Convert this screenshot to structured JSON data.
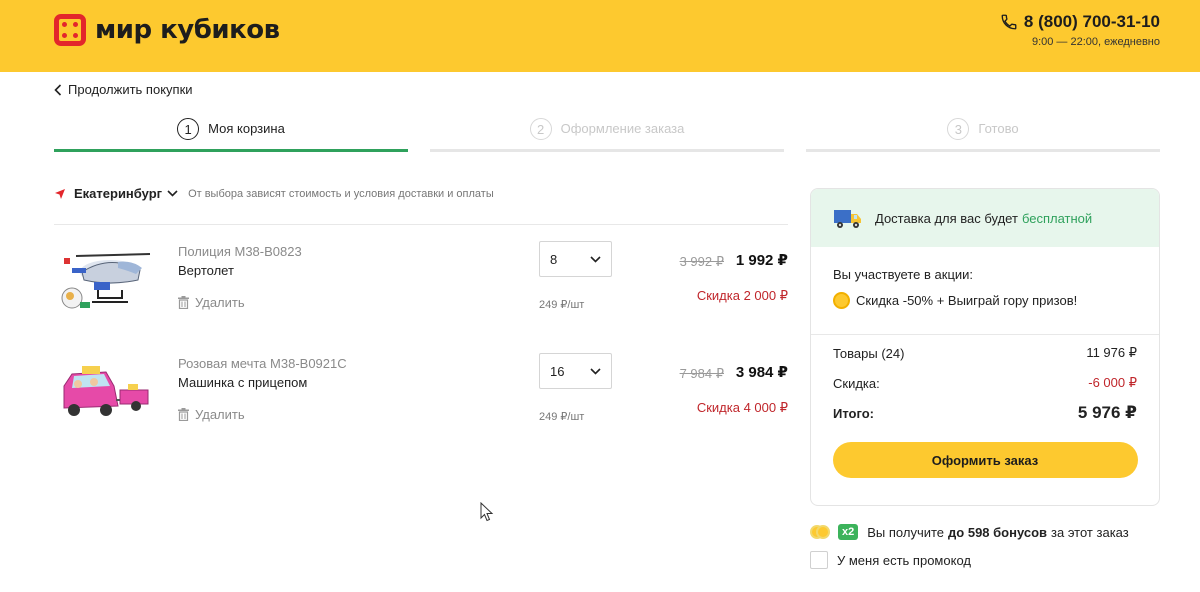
{
  "header": {
    "logo_text": "мир кубиков",
    "phone": "8 (800) 700-31-10",
    "hours": "9:00 — 22:00, ежедневно",
    "color": "#fdc92f",
    "logo_color": "#e3262b"
  },
  "nav": {
    "back_label": "Продолжить покупки"
  },
  "steps": [
    {
      "num": "1",
      "label": "Моя корзина",
      "active": true
    },
    {
      "num": "2",
      "label": "Оформление заказа",
      "active": false
    },
    {
      "num": "3",
      "label": "Готово",
      "active": false
    }
  ],
  "location": {
    "city": "Екатеринбург",
    "note": "От выбора зависят стоимость и условия доставки и оплаты"
  },
  "items": [
    {
      "series": "Полиция M38-B0823",
      "name": "Вертолет",
      "delete_label": "Удалить",
      "qty": "8",
      "unit_price": "249 ₽/шт",
      "old_price": "3 992 ₽",
      "price": "1 992 ₽",
      "discount": "Скидка 2 000 ₽"
    },
    {
      "series": "Розовая мечта M38-B0921C",
      "name": "Машинка с прицепом",
      "delete_label": "Удалить",
      "qty": "16",
      "unit_price": "249 ₽/шт",
      "old_price": "7 984 ₽",
      "price": "3 984 ₽",
      "discount": "Скидка 4 000 ₽"
    }
  ],
  "summary": {
    "delivery_text": "Доставка для вас будет",
    "delivery_free": "бесплатной",
    "promo_title": "Вы участвуете в акции:",
    "promo_name": "Скидка -50% + Выиграй гору призов!",
    "goods_label": "Товары (24)",
    "goods_value": "11 976 ₽",
    "discount_label": "Скидка:",
    "discount_value": "-6 000 ₽",
    "total_label": "Итого:",
    "total_value": "5 976 ₽",
    "order_button": "Оформить заказ"
  },
  "bonus": {
    "badge": "x2",
    "text_before": "Вы получите",
    "amount": "до 598 бонусов",
    "text_after": "за этот заказ"
  },
  "promocode": {
    "label": "У меня есть промокод"
  }
}
